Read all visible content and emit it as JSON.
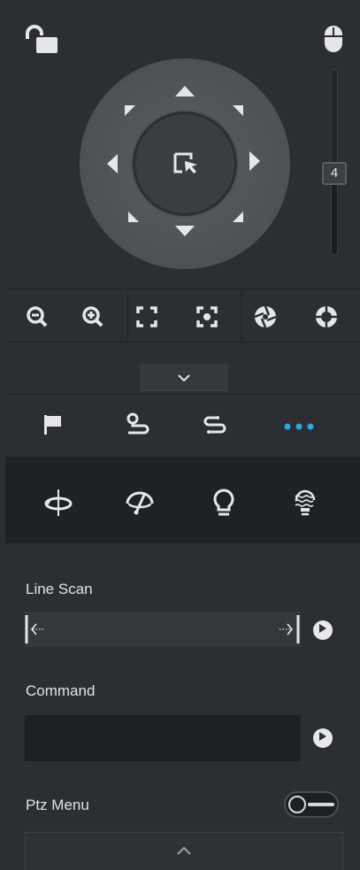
{
  "colors": {
    "accent": "#2aa6e8",
    "panel_bg": "#2b2f33",
    "dark_bg": "#1e2226",
    "icon": "#e6e6e6"
  },
  "header": {
    "lock_icon": "unlock-icon",
    "mouse_icon": "mouse-icon"
  },
  "joystick": {
    "center_icon": "select-area-icon",
    "directions": [
      "up",
      "up-right",
      "right",
      "down-right",
      "down",
      "down-left",
      "left",
      "up-left"
    ]
  },
  "speed": {
    "value": "4",
    "min": 1,
    "max": 8
  },
  "toolbar": {
    "items": [
      {
        "icon": "zoom-out-icon"
      },
      {
        "icon": "zoom-in-icon"
      },
      {
        "icon": "focus-near-icon"
      },
      {
        "icon": "focus-far-icon"
      },
      {
        "icon": "iris-close-icon"
      },
      {
        "icon": "iris-open-icon"
      }
    ]
  },
  "tabs": {
    "items": [
      {
        "icon": "preset-flag-icon"
      },
      {
        "icon": "tour-icon"
      },
      {
        "icon": "pattern-icon"
      },
      {
        "icon": "more-icon",
        "active": true
      }
    ]
  },
  "functions": {
    "items": [
      {
        "icon": "rotate-icon"
      },
      {
        "icon": "wiper-icon"
      },
      {
        "icon": "light-icon"
      },
      {
        "icon": "defog-light-icon"
      }
    ]
  },
  "line_scan": {
    "label": "Line Scan"
  },
  "command": {
    "label": "Command",
    "value": "",
    "placeholder": ""
  },
  "ptz_menu": {
    "label": "Ptz Menu",
    "enabled": false
  }
}
